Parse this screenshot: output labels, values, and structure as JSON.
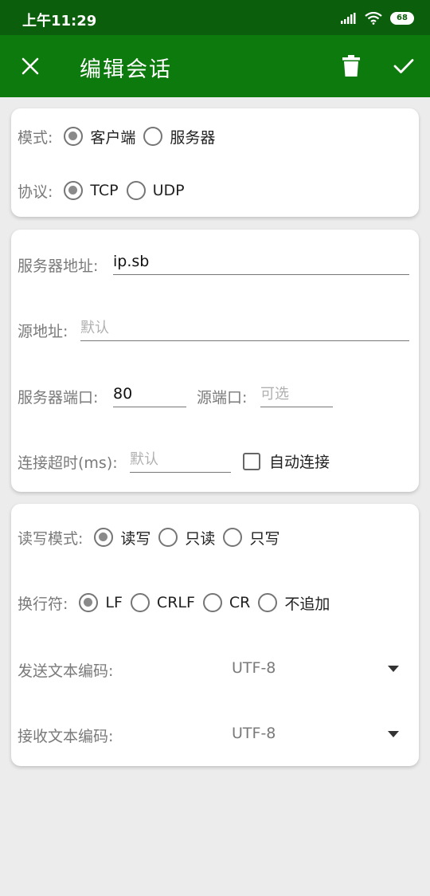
{
  "status": {
    "time": "上午11:29",
    "battery": "68"
  },
  "appbar": {
    "title": "编辑会话",
    "close_icon": "close-icon",
    "delete_icon": "trash-icon",
    "confirm_icon": "check-icon"
  },
  "card1": {
    "mode_label": "模式:",
    "mode_options": [
      "客户端",
      "服务器"
    ],
    "mode_selected": "客户端",
    "protocol_label": "协议:",
    "protocol_options": [
      "TCP",
      "UDP"
    ],
    "protocol_selected": "TCP"
  },
  "card2": {
    "server_addr_label": "服务器地址:",
    "server_addr_value": "ip.sb",
    "source_addr_label": "源地址:",
    "source_addr_placeholder": "默认",
    "server_port_label": "服务器端口:",
    "server_port_value": "80",
    "source_port_label": "源端口:",
    "source_port_placeholder": "可选",
    "timeout_label": "连接超时(ms):",
    "timeout_placeholder": "默认",
    "auto_connect_label": "自动连接",
    "auto_connect_checked": false
  },
  "card3": {
    "rw_label": "读写模式:",
    "rw_options": [
      "读写",
      "只读",
      "只写"
    ],
    "rw_selected": "读写",
    "newline_label": "换行符:",
    "newline_options": [
      "LF",
      "CRLF",
      "CR",
      "不追加"
    ],
    "newline_selected": "LF",
    "send_enc_label": "发送文本编码:",
    "send_enc_value": "UTF-8",
    "recv_enc_label": "接收文本编码:",
    "recv_enc_value": "UTF-8"
  }
}
